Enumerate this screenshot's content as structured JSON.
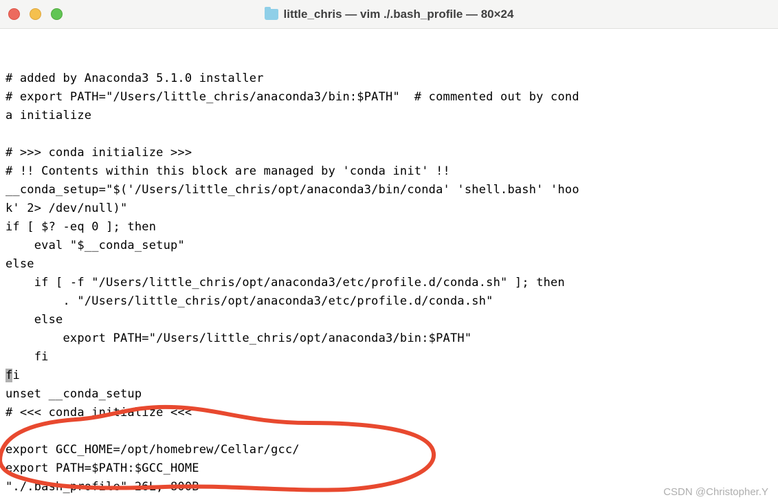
{
  "titlebar": {
    "title": "little_chris — vim ./.bash_profile — 80×24"
  },
  "editor": {
    "lines": [
      "",
      "# added by Anaconda3 5.1.0 installer",
      "# export PATH=\"/Users/little_chris/anaconda3/bin:$PATH\"  # commented out by conda initialize",
      "",
      "# >>> conda initialize >>>",
      "# !! Contents within this block are managed by 'conda init' !!",
      "__conda_setup=\"$('/Users/little_chris/opt/anaconda3/bin/conda' 'shell.bash' 'hook' 2> /dev/null)\"",
      "if [ $? -eq 0 ]; then",
      "    eval \"$__conda_setup\"",
      "else",
      "    if [ -f \"/Users/little_chris/opt/anaconda3/etc/profile.d/conda.sh\" ]; then",
      "        . \"/Users/little_chris/opt/anaconda3/etc/profile.d/conda.sh\"",
      "    else",
      "        export PATH=\"/Users/little_chris/opt/anaconda3/bin:$PATH\"",
      "    fi"
    ],
    "cursor_line_before": "f",
    "cursor_line_after": "i",
    "lines_after": [
      "unset __conda_setup",
      "# <<< conda initialize <<<",
      "",
      "export GCC_HOME=/opt/homebrew/Cellar/gcc/",
      "export PATH=$PATH:$GCC_HOME"
    ],
    "status_line": "\"./.bash_profile\" 26L, 800B"
  },
  "watermark": "CSDN @Christopher.Y"
}
